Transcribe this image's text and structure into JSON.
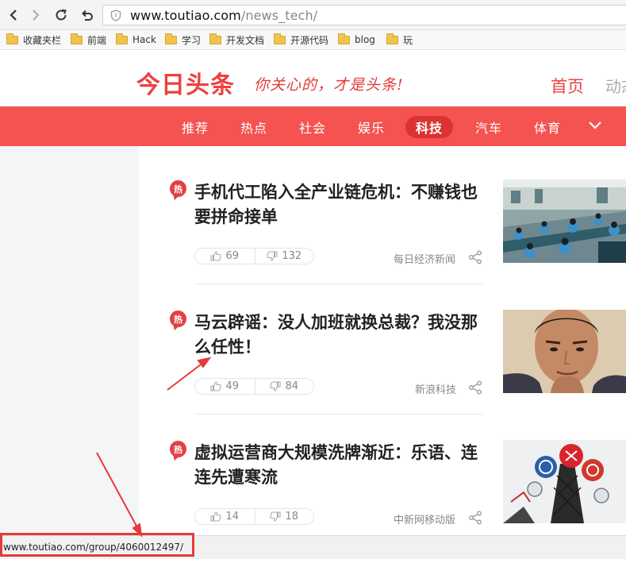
{
  "browser": {
    "url_host": "www.toutiao.com",
    "url_path": "/news_tech/",
    "bookmarks": [
      "收藏夹栏",
      "前端",
      "Hack",
      "学习",
      "开发文档",
      "开源代码",
      "blog",
      "玩"
    ]
  },
  "header": {
    "logo": "今日头条",
    "slogan": "你关心的，才是头条!",
    "home_link": "首页",
    "dong_link": "动态"
  },
  "channels": [
    "推荐",
    "热点",
    "社会",
    "娱乐",
    "科技",
    "汽车",
    "体育"
  ],
  "active_channel": "科技",
  "hot_badge": "热",
  "articles": [
    {
      "title": "手机代工陷入全产业链危机：不赚钱也要拼命接单",
      "likes": "69",
      "dislikes": "132",
      "source": "每日经济新闻"
    },
    {
      "title": "马云辟谣：没人加班就换总裁？我没那么任性！",
      "likes": "49",
      "dislikes": "84",
      "source": "新浪科技"
    },
    {
      "title": "虚拟运营商大规模洗牌渐近：乐语、连连先遭寒流",
      "likes": "14",
      "dislikes": "18",
      "source": "中新网移动版"
    }
  ],
  "status_bar": {
    "url": "www.toutiao.com/group/4060012497/"
  },
  "colors": {
    "brand_red": "#f55252",
    "logo_red": "#ed4040",
    "annotation_red": "#e63a3a"
  }
}
